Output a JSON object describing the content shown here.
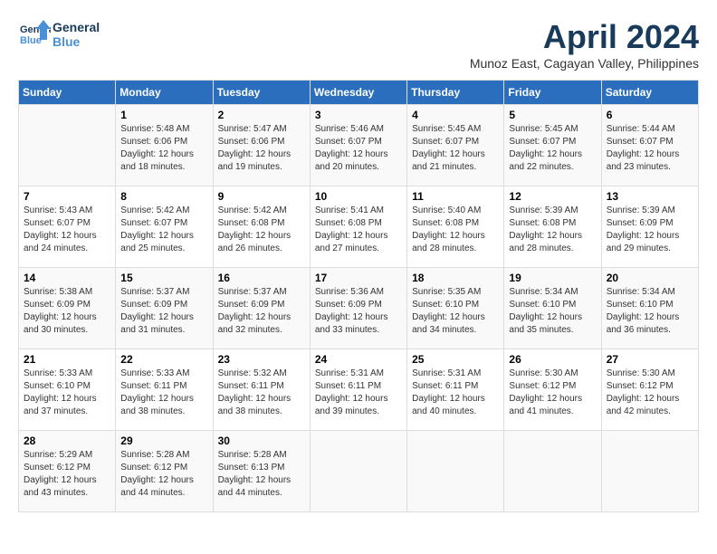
{
  "header": {
    "logo_line1": "General",
    "logo_line2": "Blue",
    "month": "April 2024",
    "location": "Munoz East, Cagayan Valley, Philippines"
  },
  "weekdays": [
    "Sunday",
    "Monday",
    "Tuesday",
    "Wednesday",
    "Thursday",
    "Friday",
    "Saturday"
  ],
  "weeks": [
    [
      {
        "day": "",
        "sunrise": "",
        "sunset": "",
        "daylight": ""
      },
      {
        "day": "1",
        "sunrise": "Sunrise: 5:48 AM",
        "sunset": "Sunset: 6:06 PM",
        "daylight": "Daylight: 12 hours and 18 minutes."
      },
      {
        "day": "2",
        "sunrise": "Sunrise: 5:47 AM",
        "sunset": "Sunset: 6:06 PM",
        "daylight": "Daylight: 12 hours and 19 minutes."
      },
      {
        "day": "3",
        "sunrise": "Sunrise: 5:46 AM",
        "sunset": "Sunset: 6:07 PM",
        "daylight": "Daylight: 12 hours and 20 minutes."
      },
      {
        "day": "4",
        "sunrise": "Sunrise: 5:45 AM",
        "sunset": "Sunset: 6:07 PM",
        "daylight": "Daylight: 12 hours and 21 minutes."
      },
      {
        "day": "5",
        "sunrise": "Sunrise: 5:45 AM",
        "sunset": "Sunset: 6:07 PM",
        "daylight": "Daylight: 12 hours and 22 minutes."
      },
      {
        "day": "6",
        "sunrise": "Sunrise: 5:44 AM",
        "sunset": "Sunset: 6:07 PM",
        "daylight": "Daylight: 12 hours and 23 minutes."
      }
    ],
    [
      {
        "day": "7",
        "sunrise": "Sunrise: 5:43 AM",
        "sunset": "Sunset: 6:07 PM",
        "daylight": "Daylight: 12 hours and 24 minutes."
      },
      {
        "day": "8",
        "sunrise": "Sunrise: 5:42 AM",
        "sunset": "Sunset: 6:07 PM",
        "daylight": "Daylight: 12 hours and 25 minutes."
      },
      {
        "day": "9",
        "sunrise": "Sunrise: 5:42 AM",
        "sunset": "Sunset: 6:08 PM",
        "daylight": "Daylight: 12 hours and 26 minutes."
      },
      {
        "day": "10",
        "sunrise": "Sunrise: 5:41 AM",
        "sunset": "Sunset: 6:08 PM",
        "daylight": "Daylight: 12 hours and 27 minutes."
      },
      {
        "day": "11",
        "sunrise": "Sunrise: 5:40 AM",
        "sunset": "Sunset: 6:08 PM",
        "daylight": "Daylight: 12 hours and 28 minutes."
      },
      {
        "day": "12",
        "sunrise": "Sunrise: 5:39 AM",
        "sunset": "Sunset: 6:08 PM",
        "daylight": "Daylight: 12 hours and 28 minutes."
      },
      {
        "day": "13",
        "sunrise": "Sunrise: 5:39 AM",
        "sunset": "Sunset: 6:09 PM",
        "daylight": "Daylight: 12 hours and 29 minutes."
      }
    ],
    [
      {
        "day": "14",
        "sunrise": "Sunrise: 5:38 AM",
        "sunset": "Sunset: 6:09 PM",
        "daylight": "Daylight: 12 hours and 30 minutes."
      },
      {
        "day": "15",
        "sunrise": "Sunrise: 5:37 AM",
        "sunset": "Sunset: 6:09 PM",
        "daylight": "Daylight: 12 hours and 31 minutes."
      },
      {
        "day": "16",
        "sunrise": "Sunrise: 5:37 AM",
        "sunset": "Sunset: 6:09 PM",
        "daylight": "Daylight: 12 hours and 32 minutes."
      },
      {
        "day": "17",
        "sunrise": "Sunrise: 5:36 AM",
        "sunset": "Sunset: 6:09 PM",
        "daylight": "Daylight: 12 hours and 33 minutes."
      },
      {
        "day": "18",
        "sunrise": "Sunrise: 5:35 AM",
        "sunset": "Sunset: 6:10 PM",
        "daylight": "Daylight: 12 hours and 34 minutes."
      },
      {
        "day": "19",
        "sunrise": "Sunrise: 5:34 AM",
        "sunset": "Sunset: 6:10 PM",
        "daylight": "Daylight: 12 hours and 35 minutes."
      },
      {
        "day": "20",
        "sunrise": "Sunrise: 5:34 AM",
        "sunset": "Sunset: 6:10 PM",
        "daylight": "Daylight: 12 hours and 36 minutes."
      }
    ],
    [
      {
        "day": "21",
        "sunrise": "Sunrise: 5:33 AM",
        "sunset": "Sunset: 6:10 PM",
        "daylight": "Daylight: 12 hours and 37 minutes."
      },
      {
        "day": "22",
        "sunrise": "Sunrise: 5:33 AM",
        "sunset": "Sunset: 6:11 PM",
        "daylight": "Daylight: 12 hours and 38 minutes."
      },
      {
        "day": "23",
        "sunrise": "Sunrise: 5:32 AM",
        "sunset": "Sunset: 6:11 PM",
        "daylight": "Daylight: 12 hours and 38 minutes."
      },
      {
        "day": "24",
        "sunrise": "Sunrise: 5:31 AM",
        "sunset": "Sunset: 6:11 PM",
        "daylight": "Daylight: 12 hours and 39 minutes."
      },
      {
        "day": "25",
        "sunrise": "Sunrise: 5:31 AM",
        "sunset": "Sunset: 6:11 PM",
        "daylight": "Daylight: 12 hours and 40 minutes."
      },
      {
        "day": "26",
        "sunrise": "Sunrise: 5:30 AM",
        "sunset": "Sunset: 6:12 PM",
        "daylight": "Daylight: 12 hours and 41 minutes."
      },
      {
        "day": "27",
        "sunrise": "Sunrise: 5:30 AM",
        "sunset": "Sunset: 6:12 PM",
        "daylight": "Daylight: 12 hours and 42 minutes."
      }
    ],
    [
      {
        "day": "28",
        "sunrise": "Sunrise: 5:29 AM",
        "sunset": "Sunset: 6:12 PM",
        "daylight": "Daylight: 12 hours and 43 minutes."
      },
      {
        "day": "29",
        "sunrise": "Sunrise: 5:28 AM",
        "sunset": "Sunset: 6:12 PM",
        "daylight": "Daylight: 12 hours and 44 minutes."
      },
      {
        "day": "30",
        "sunrise": "Sunrise: 5:28 AM",
        "sunset": "Sunset: 6:13 PM",
        "daylight": "Daylight: 12 hours and 44 minutes."
      },
      {
        "day": "",
        "sunrise": "",
        "sunset": "",
        "daylight": ""
      },
      {
        "day": "",
        "sunrise": "",
        "sunset": "",
        "daylight": ""
      },
      {
        "day": "",
        "sunrise": "",
        "sunset": "",
        "daylight": ""
      },
      {
        "day": "",
        "sunrise": "",
        "sunset": "",
        "daylight": ""
      }
    ]
  ]
}
